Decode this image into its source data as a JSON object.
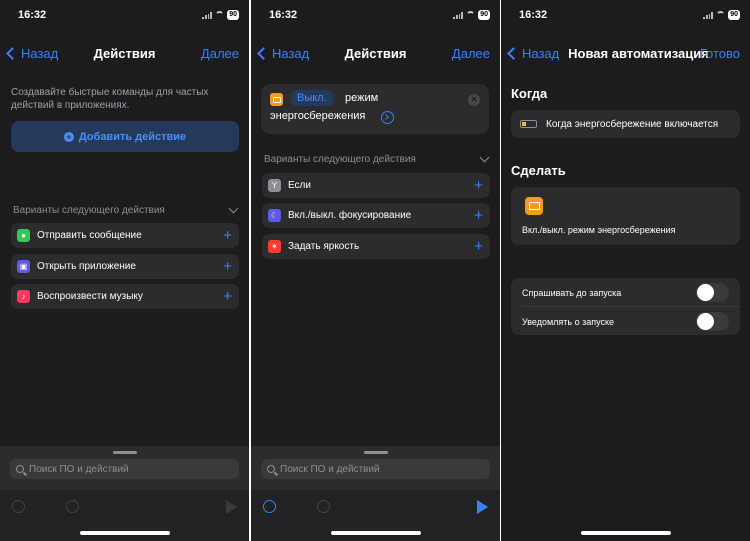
{
  "status": {
    "time": "16:32",
    "battery": "90"
  },
  "screen1": {
    "back": "Назад",
    "title": "Действия",
    "next": "Далее",
    "hint": "Создавайте быстрые команды для частых действий в приложениях.",
    "add_action": "Добавить действие",
    "section_title": "Варианты следующего действия",
    "suggestions": [
      {
        "label": "Отправить сообщение",
        "icon": "messages-icon",
        "color": "#34c759"
      },
      {
        "label": "Открыть приложение",
        "icon": "app-icon",
        "color": "#5e5ce6"
      },
      {
        "label": "Воспроизвести музыку",
        "icon": "music-icon",
        "color": "#ff375f"
      }
    ],
    "search_placeholder": "Поиск ПО и действий"
  },
  "screen2": {
    "back": "Назад",
    "title": "Действия",
    "next": "Далее",
    "action": {
      "token": "Выкл.",
      "text1": "режим",
      "text2": "энергосбережения"
    },
    "section_title": "Варианты следующего действия",
    "suggestions": [
      {
        "label": "Если",
        "icon": "if-icon",
        "color": "#8e8e93"
      },
      {
        "label": "Вкл./выкл. фокусирование",
        "icon": "moon-icon",
        "color": "#5e5ce6"
      },
      {
        "label": "Задать яркость",
        "icon": "brightness-icon",
        "color": "#ff3b30"
      }
    ],
    "search_placeholder": "Поиск ПО и действий"
  },
  "screen3": {
    "back": "Назад",
    "title": "Новая автоматизация",
    "done": "Готово",
    "when_heading": "Когда",
    "trigger": "Когда энергосбережение включается",
    "do_heading": "Сделать",
    "do_action": "Вкл./выкл. режим энергосбережения",
    "options": [
      {
        "label": "Спрашивать до запуска",
        "on": false
      },
      {
        "label": "Уведомлять о запуске",
        "on": false
      }
    ]
  },
  "colors": {
    "background": "#1c1c1e",
    "card": "#2c2c2e",
    "accent": "#3a82f7",
    "orange": "#f29d20"
  }
}
